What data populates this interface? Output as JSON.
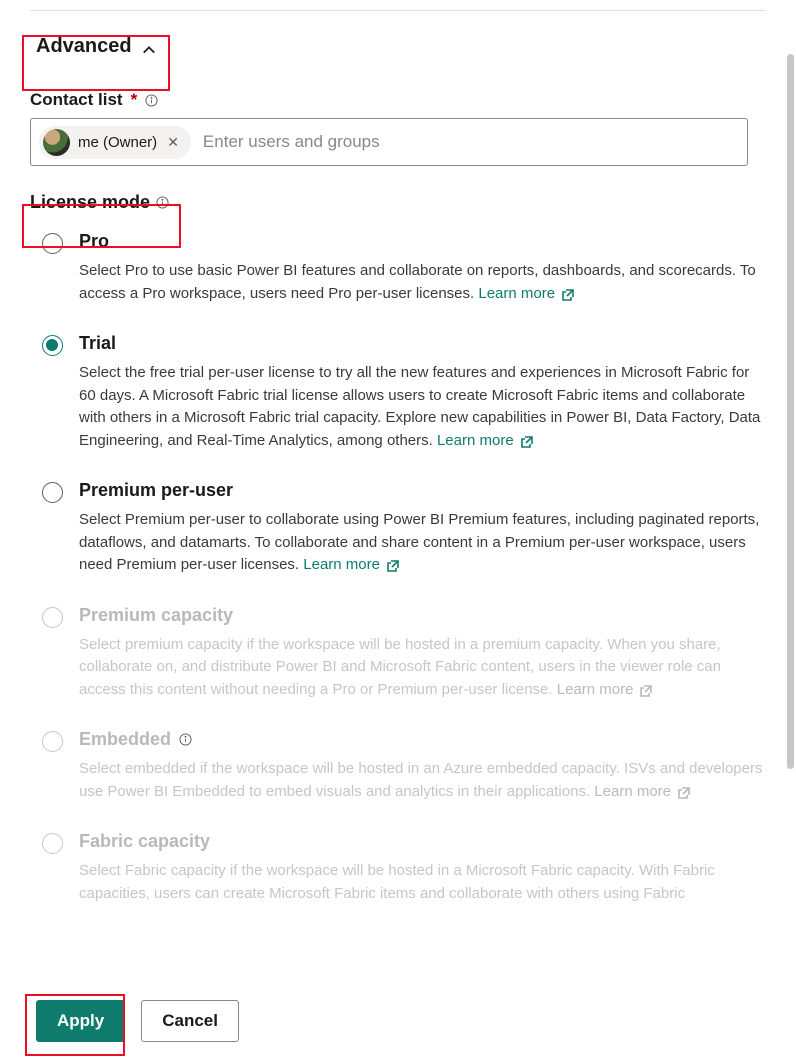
{
  "section": {
    "title": "Advanced"
  },
  "contact": {
    "label": "Contact list",
    "required_marker": "*",
    "chip_label": "me (Owner)",
    "placeholder": "Enter users and groups"
  },
  "license": {
    "label": "License mode",
    "items": [
      {
        "title": "Pro",
        "desc": "Select Pro to use basic Power BI features and collaborate on reports, dashboards, and scorecards. To access a Pro workspace, users need Pro per-user licenses.",
        "link": "Learn more",
        "checked": false,
        "disabled": false,
        "has_info": false
      },
      {
        "title": "Trial",
        "desc": "Select the free trial per-user license to try all the new features and experiences in Microsoft Fabric for 60 days. A Microsoft Fabric trial license allows users to create Microsoft Fabric items and collaborate with others in a Microsoft Fabric trial capacity. Explore new capabilities in Power BI, Data Factory, Data Engineering, and Real-Time Analytics, among others.",
        "link": "Learn more",
        "checked": true,
        "disabled": false,
        "has_info": false
      },
      {
        "title": "Premium per-user",
        "desc": "Select Premium per-user to collaborate using Power BI Premium features, including paginated reports, dataflows, and datamarts. To collaborate and share content in a Premium per-user workspace, users need Premium per-user licenses.",
        "link": "Learn more",
        "checked": false,
        "disabled": false,
        "has_info": false
      },
      {
        "title": "Premium capacity",
        "desc": "Select premium capacity if the workspace will be hosted in a premium capacity. When you share, collaborate on, and distribute Power BI and Microsoft Fabric content, users in the viewer role can access this content without needing a Pro or Premium per-user license.",
        "link": "Learn more",
        "checked": false,
        "disabled": true,
        "has_info": false
      },
      {
        "title": "Embedded",
        "desc": "Select embedded if the workspace will be hosted in an Azure embedded capacity. ISVs and developers use Power BI Embedded to embed visuals and analytics in their applications.",
        "link": "Learn more",
        "checked": false,
        "disabled": true,
        "has_info": true
      },
      {
        "title": "Fabric capacity",
        "desc": "Select Fabric capacity if the workspace will be hosted in a Microsoft Fabric capacity. With Fabric capacities, users can create Microsoft Fabric items and collaborate with others using Fabric",
        "link": "",
        "checked": false,
        "disabled": true,
        "has_info": false
      }
    ]
  },
  "footer": {
    "apply_label": "Apply",
    "cancel_label": "Cancel"
  }
}
